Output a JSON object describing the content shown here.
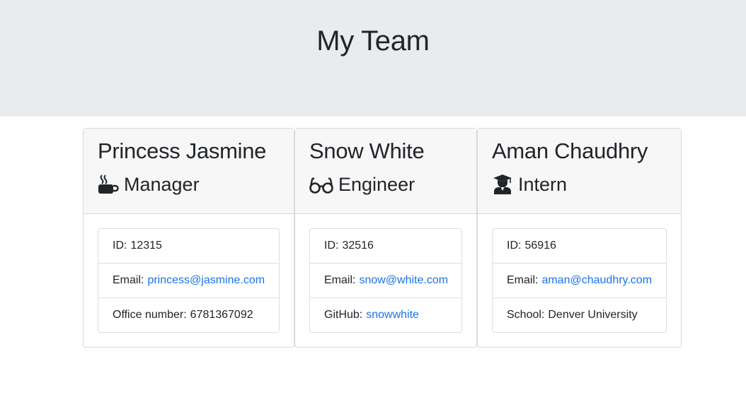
{
  "page": {
    "title": "My Team"
  },
  "colors": {
    "header_bg": "#e9ecef",
    "link": "#1a73e8",
    "card_header_bg": "#f7f7f7"
  },
  "cards": [
    {
      "name": "Princess Jasmine",
      "role": "Manager",
      "role_icon": "coffee-mug-icon",
      "id_label": "ID:",
      "id": "12315",
      "email_label": "Email:",
      "email": "princess@jasmine.com",
      "extra_label": "Office number:",
      "extra": "6781367092"
    },
    {
      "name": "Snow White",
      "role": "Engineer",
      "role_icon": "glasses-icon",
      "id_label": "ID:",
      "id": "32516",
      "email_label": "Email:",
      "email": "snow@white.com",
      "extra_label": "GitHub:",
      "extra": "snowwhite"
    },
    {
      "name": "Aman Chaudhry",
      "role": "Intern",
      "role_icon": "graduate-icon",
      "id_label": "ID:",
      "id": "56916",
      "email_label": "Email:",
      "email": "aman@chaudhry.com",
      "extra_label": "School:",
      "extra": "Denver University"
    }
  ]
}
